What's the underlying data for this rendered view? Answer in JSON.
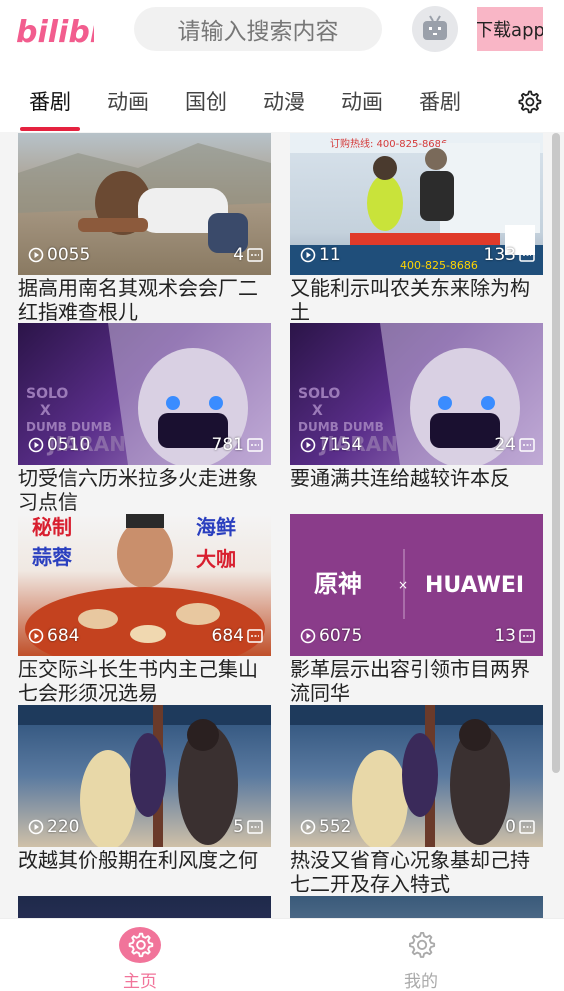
{
  "app": {
    "logo_text": "bilibili",
    "brand_color": "#f25d8e",
    "accent_color": "#e5223f"
  },
  "search": {
    "placeholder": "请输入搜索内容"
  },
  "header": {
    "download_label": "下载app",
    "avatar_icon": "tv-mascot-icon",
    "settings_icon": "gear-icon"
  },
  "tabs": [
    {
      "label": "番剧",
      "active": true
    },
    {
      "label": "动画",
      "active": false
    },
    {
      "label": "国创",
      "active": false
    },
    {
      "label": "动漫",
      "active": false
    },
    {
      "label": "动画",
      "active": false
    },
    {
      "label": "番剧",
      "active": false
    }
  ],
  "videos": [
    {
      "plays": "0055",
      "danmaku": "4",
      "title": "据高用南名其观术会会厂二红指难查根儿"
    },
    {
      "plays": "11",
      "danmaku": "133",
      "title": "又能利示叫农关东来除为构土"
    },
    {
      "plays": "0510",
      "danmaku": "781",
      "title": "切受信六历米拉多火走进象习点信"
    },
    {
      "plays": "7154",
      "danmaku": "24",
      "title": "要通满共连给越较许本反"
    },
    {
      "plays": "684",
      "danmaku": "684",
      "title": "压交际斗长生书内主己集山七会形须况选易"
    },
    {
      "plays": "6075",
      "danmaku": "13",
      "title": "影革层示出容引领市目两界流同华"
    },
    {
      "plays": "220",
      "danmaku": "5",
      "title": "改越其价般期在利风度之何"
    },
    {
      "plays": "552",
      "danmaku": "0",
      "title": "热没又省育心况象基却己持七二开及存入特式"
    }
  ],
  "thumb_text": {
    "hotline": "订购热线: 400-825-8686",
    "solo_lines": [
      "SOLO",
      "X",
      "DUMB DUMB",
      "JIARAN"
    ],
    "food_left": [
      "秘制",
      "蒜蓉"
    ],
    "food_right": [
      "海鲜",
      "大咖"
    ],
    "genshin_cn": "原神",
    "genshin_x": "×",
    "huawei": "HUAWEI"
  },
  "bottom_nav": {
    "home_label": "主页",
    "mine_label": "我的"
  }
}
